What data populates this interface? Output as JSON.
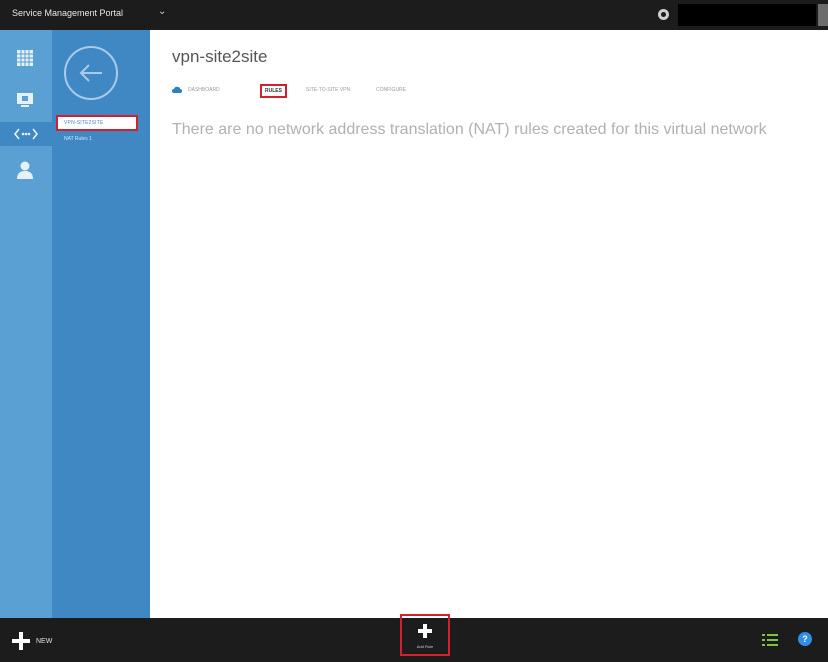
{
  "topbar": {
    "portal_title": "Service Management Portal",
    "menu_chevron": "⌄"
  },
  "nav": {
    "icons": [
      "grid-icon",
      "monitor-icon",
      "network-icon",
      "user-icon"
    ],
    "selected": "network-icon"
  },
  "subnav": {
    "items": [
      {
        "label": "VPN-SITE2SITE",
        "selected": true
      },
      {
        "label": "NAT Rules 1",
        "selected": false
      }
    ]
  },
  "main": {
    "title": "vpn-site2site",
    "tabs": [
      {
        "label": "DASHBOARD",
        "active": false
      },
      {
        "label": "RULES",
        "active": true
      },
      {
        "label": "SITE-TO-SITE VPN",
        "active": false
      },
      {
        "label": "CONFIGURE",
        "active": false
      }
    ],
    "empty_message": "There are no network address translation (NAT) rules created for this virtual network"
  },
  "bottombar": {
    "new_label": "NEW",
    "add_rule_label": "Add Rule",
    "help_glyph": "?"
  },
  "colors": {
    "accent_red": "#d3202e",
    "nav_blue": "#5aa0d2",
    "subnav_blue": "#3f88c4",
    "bar_dark": "#1c1c1c"
  }
}
